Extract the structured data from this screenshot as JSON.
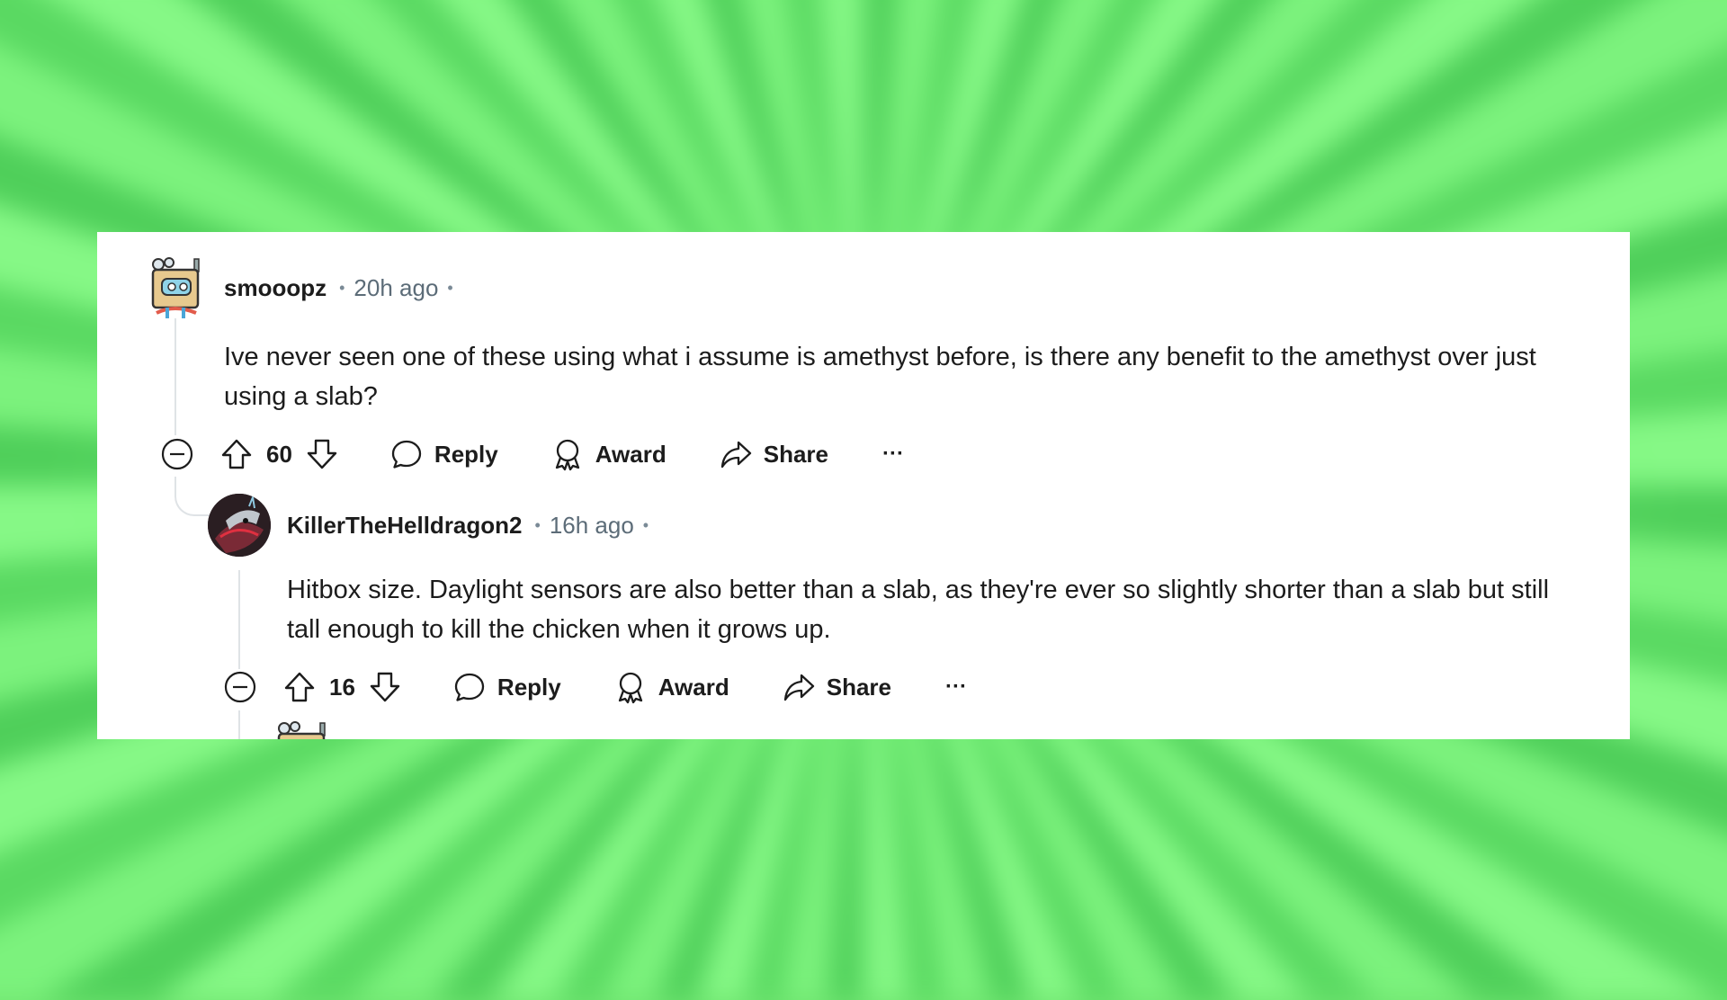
{
  "comments": [
    {
      "username": "smooopz",
      "time": "20h ago",
      "body": "Ive never seen one of these using what i assume is amethyst before, is there any benefit to the amethyst over just using a slab?",
      "score": "60",
      "actions": {
        "reply": "Reply",
        "award": "Award",
        "share": "Share",
        "more": "···"
      }
    },
    {
      "username": "KillerTheHelldragon2",
      "time": "16h ago",
      "body": "Hitbox size. Daylight sensors are also better than a slab, as they're ever so slightly shorter than a slab but still tall enough to kill the chicken when it grows up.",
      "score": "16",
      "actions": {
        "reply": "Reply",
        "award": "Award",
        "share": "Share",
        "more": "···"
      }
    }
  ],
  "meta_separator": "•",
  "colors": {
    "background": "#6fe46f",
    "card": "#ffffff",
    "text": "#1c1c1c",
    "muted": "#5c6c78",
    "thread": "#dfe3e6"
  }
}
